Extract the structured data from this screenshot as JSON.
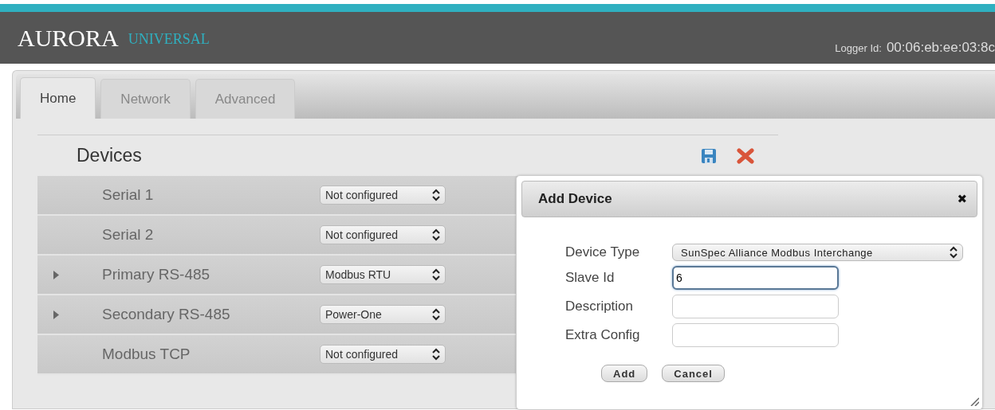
{
  "header": {
    "brand": "AURORA",
    "product": "UNIVERSAL",
    "logger_label": "Logger Id:",
    "logger_id": "00:06:eb:ee:03:8c"
  },
  "tabs": [
    {
      "label": "Home",
      "selected": true
    },
    {
      "label": "Network",
      "selected": false
    },
    {
      "label": "Advanced",
      "selected": false
    }
  ],
  "devices": {
    "title": "Devices",
    "rows": [
      {
        "name": "Serial 1",
        "expandable": false,
        "protocol": "Not configured"
      },
      {
        "name": "Serial 2",
        "expandable": false,
        "protocol": "Not configured"
      },
      {
        "name": "Primary RS-485",
        "expandable": true,
        "protocol": "Modbus RTU"
      },
      {
        "name": "Secondary RS-485",
        "expandable": true,
        "protocol": "Power-One"
      },
      {
        "name": "Modbus TCP",
        "expandable": false,
        "protocol": "Not configured"
      }
    ]
  },
  "dialog": {
    "title": "Add Device",
    "close": "✖",
    "fields": [
      {
        "kind": "select",
        "label": "Device Type",
        "value": "SunSpec Alliance Modbus Interchange",
        "focused": false
      },
      {
        "kind": "text",
        "label": "Slave Id",
        "value": "6",
        "focused": true
      },
      {
        "kind": "text",
        "label": "Description",
        "focused": false
      },
      {
        "kind": "text",
        "label": "Extra Config",
        "focused": false
      }
    ],
    "buttons": [
      "Add",
      "Cancel"
    ]
  }
}
